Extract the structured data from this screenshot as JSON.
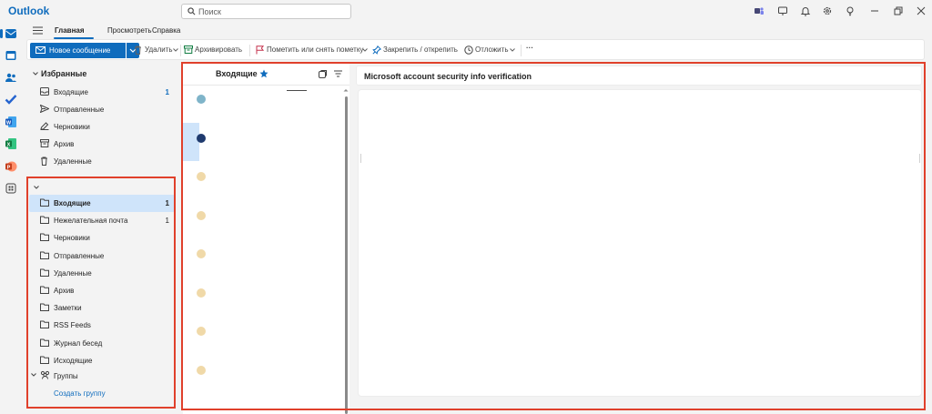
{
  "titlebar": {
    "app_name": "Outlook",
    "search_placeholder": "Поиск",
    "icons": [
      "teams-icon",
      "whiteboard-icon",
      "bell-icon",
      "gear-icon",
      "lightbulb-icon",
      "minimize-icon",
      "restore-icon",
      "close-icon"
    ]
  },
  "ribbon": {
    "tabs": [
      {
        "label": "Главная",
        "active": true
      },
      {
        "label": "Просмотреть",
        "active": false
      },
      {
        "label": "Справка",
        "active": false
      }
    ],
    "new_message": "Новое сообщение",
    "commands": {
      "delete": "Удалить",
      "archive": "Архивировать",
      "flag": "Пометить или снять пометку",
      "pin": "Закрепить / открепить",
      "snooze": "Отложить",
      "more": "···"
    }
  },
  "leftrail": {
    "icons": [
      "mail-icon",
      "calendar-icon",
      "people-icon",
      "todo-icon",
      "word-icon",
      "excel-icon",
      "powerpoint-icon",
      "apps-icon"
    ]
  },
  "favorites": {
    "title": "Избранные",
    "items": [
      {
        "label": "Входящие",
        "count": "1",
        "icon": "inbox-icon"
      },
      {
        "label": "Отправленные",
        "count": "",
        "icon": "send-icon"
      },
      {
        "label": "Черновики",
        "count": "",
        "icon": "drafts-icon"
      },
      {
        "label": "Архив",
        "count": "",
        "icon": "archive-icon"
      },
      {
        "label": "Удаленные",
        "count": "",
        "icon": "trash-icon"
      }
    ]
  },
  "account": {
    "folders": [
      {
        "label": "Входящие",
        "count": "1",
        "selected": true
      },
      {
        "label": "Нежелательная почта",
        "count": "1"
      },
      {
        "label": "Черновики",
        "count": ""
      },
      {
        "label": "Отправленные",
        "count": ""
      },
      {
        "label": "Удаленные",
        "count": ""
      },
      {
        "label": "Архив",
        "count": ""
      },
      {
        "label": "Заметки",
        "count": ""
      },
      {
        "label": "RSS Feeds",
        "count": ""
      },
      {
        "label": "Журнал бесед",
        "count": ""
      },
      {
        "label": "Исходящие",
        "count": ""
      }
    ],
    "groups_label": "Группы",
    "create_group": "Создать группу"
  },
  "message_list": {
    "title": "Входящие",
    "avatar_colors": [
      "#7fb4c9",
      "#1f3a6e",
      "#f0d9a8",
      "#f0d9a8",
      "#f0d9a8",
      "#f0d9a8",
      "#f0d9a8",
      "#f0d9a8"
    ]
  },
  "reading_pane": {
    "subject": "Microsoft account security info verification"
  },
  "colors": {
    "accent": "#0f6cbd",
    "selected": "#cfe4fa",
    "highlight_box": "#e0402b"
  }
}
